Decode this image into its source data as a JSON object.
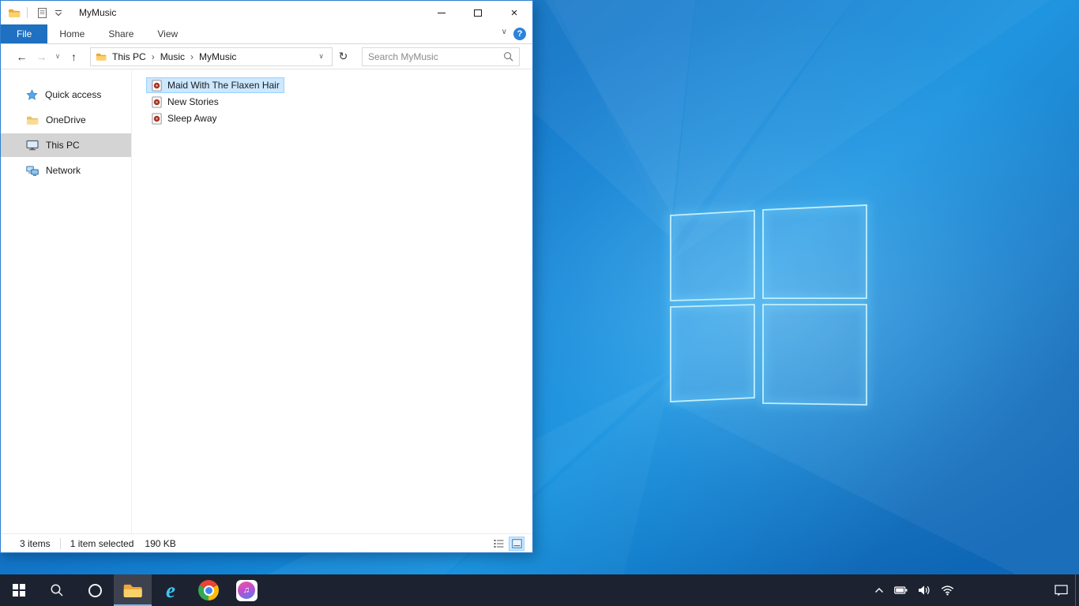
{
  "window": {
    "title": "MyMusic",
    "controls": {
      "close_glyph": "×"
    }
  },
  "ribbon": {
    "tabs": [
      "File",
      "Home",
      "Share",
      "View"
    ],
    "active_tab": "File",
    "file_tab_color": "#1f70c1"
  },
  "help_glyph": "?",
  "navigation": {
    "back_glyph": "←",
    "forward_glyph": "→",
    "up_glyph": "↑",
    "refresh_glyph": "↻",
    "dropdown_glyph": "∨",
    "breadcrumb": [
      "This PC",
      "Music",
      "MyMusic"
    ],
    "breadcrumb_separator": "›",
    "search_placeholder": "Search MyMusic"
  },
  "sidebar": {
    "items": [
      {
        "label": "Quick access",
        "icon": "star-icon",
        "selected": false
      },
      {
        "label": "OneDrive",
        "icon": "folder-icon",
        "selected": false
      },
      {
        "label": "This PC",
        "icon": "computer-icon",
        "selected": true
      },
      {
        "label": "Network",
        "icon": "network-icon",
        "selected": false
      }
    ],
    "selected_row_color": "#d4d4d4"
  },
  "file_list": {
    "items": [
      {
        "name": "Maid With The Flaxen Hair",
        "icon": "music-file-icon",
        "selected": true
      },
      {
        "name": "New Stories",
        "icon": "music-file-icon",
        "selected": false
      },
      {
        "name": "Sleep Away",
        "icon": "music-file-icon",
        "selected": false
      }
    ],
    "selection_color": "#cce8ff",
    "selection_border": "#99d1ff"
  },
  "status_bar": {
    "item_count": "3 items",
    "selection_text": "1 item selected",
    "selection_size": "190 KB"
  },
  "taskbar": {
    "background": "#1c2230",
    "accent_underline": "#76b9ed",
    "apps": [
      "start",
      "search",
      "cortana",
      "file-explorer",
      "internet-explorer",
      "chrome",
      "itunes"
    ],
    "active_app": "file-explorer",
    "ie_glyph": "e",
    "itunes_note_glyph": "♫",
    "tray": [
      "chevron-up",
      "battery",
      "volume",
      "network"
    ]
  }
}
